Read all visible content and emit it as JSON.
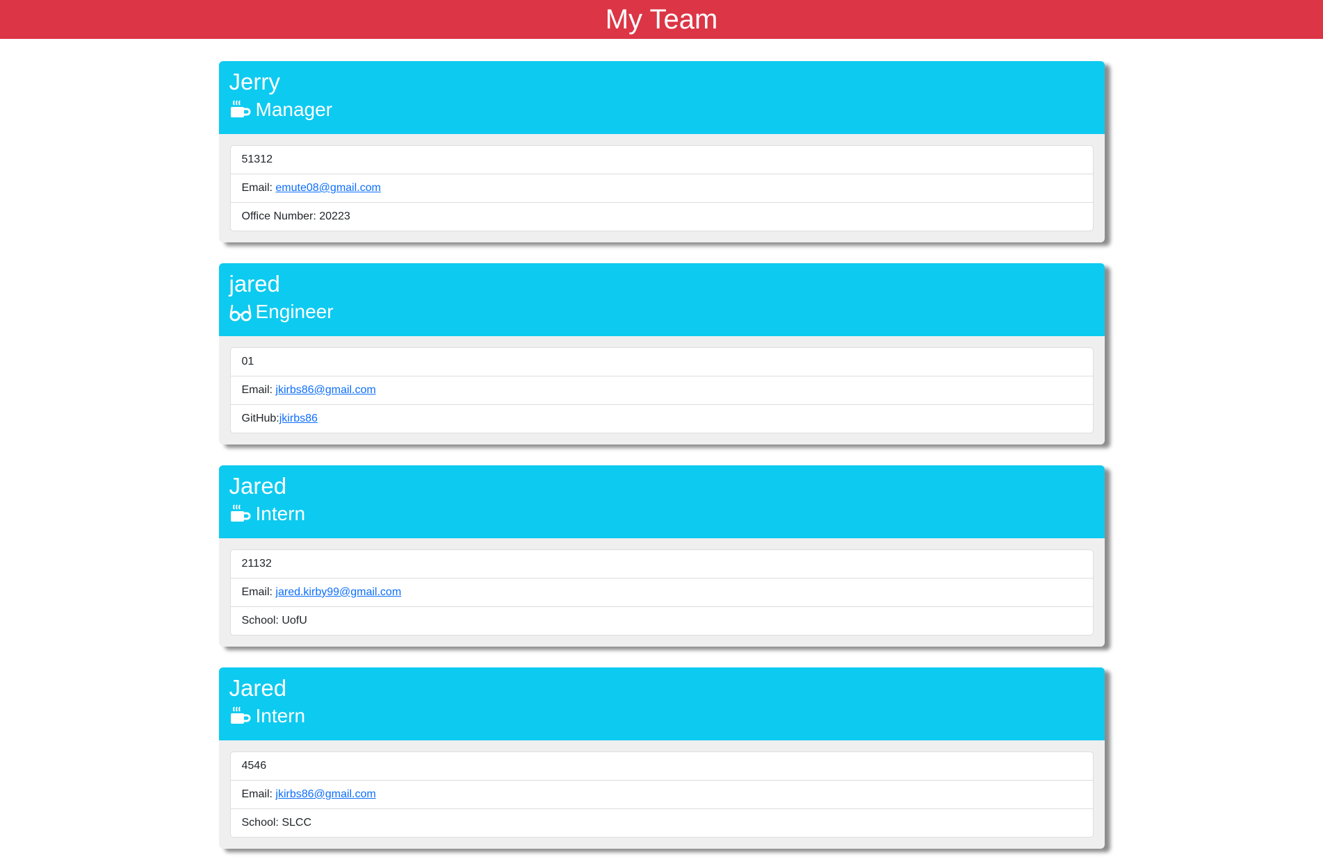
{
  "header": {
    "title": "My Team"
  },
  "colors": {
    "header_bg": "#dc3545",
    "card_header_bg": "#0dcaf0",
    "link": "#0d6efd"
  },
  "employees": [
    {
      "name": "Jerry",
      "role": "Manager",
      "icon": "mug-icon",
      "id": "51312",
      "email_label": "Email: ",
      "email": "emute08@gmail.com",
      "extra_label": "Office Number: ",
      "extra_value": "20223"
    },
    {
      "name": "jared",
      "role": "Engineer",
      "icon": "glasses-icon",
      "id": "01",
      "email_label": "Email: ",
      "email": "jkirbs86@gmail.com",
      "extra_label": "GitHub:",
      "extra_value": "jkirbs86"
    },
    {
      "name": "Jared",
      "role": "Intern",
      "icon": "mug-icon",
      "id": "21132",
      "email_label": "Email: ",
      "email": "jared.kirby99@gmail.com",
      "extra_label": "School: ",
      "extra_value": "UofU"
    },
    {
      "name": "Jared",
      "role": "Intern",
      "icon": "mug-icon",
      "id": "4546",
      "email_label": "Email: ",
      "email": "jkirbs86@gmail.com",
      "extra_label": "School: ",
      "extra_value": "SLCC"
    }
  ]
}
